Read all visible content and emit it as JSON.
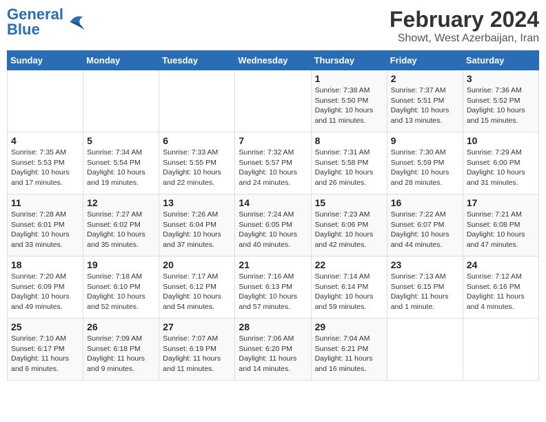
{
  "header": {
    "logo_text_general": "General",
    "logo_text_blue": "Blue",
    "title": "February 2024",
    "subtitle": "Showt, West Azerbaijan, Iran"
  },
  "weekdays": [
    "Sunday",
    "Monday",
    "Tuesday",
    "Wednesday",
    "Thursday",
    "Friday",
    "Saturday"
  ],
  "weeks": [
    [
      {
        "day": "",
        "info": ""
      },
      {
        "day": "",
        "info": ""
      },
      {
        "day": "",
        "info": ""
      },
      {
        "day": "",
        "info": ""
      },
      {
        "day": "1",
        "info": "Sunrise: 7:38 AM\nSunset: 5:50 PM\nDaylight: 10 hours\nand 11 minutes."
      },
      {
        "day": "2",
        "info": "Sunrise: 7:37 AM\nSunset: 5:51 PM\nDaylight: 10 hours\nand 13 minutes."
      },
      {
        "day": "3",
        "info": "Sunrise: 7:36 AM\nSunset: 5:52 PM\nDaylight: 10 hours\nand 15 minutes."
      }
    ],
    [
      {
        "day": "4",
        "info": "Sunrise: 7:35 AM\nSunset: 5:53 PM\nDaylight: 10 hours\nand 17 minutes."
      },
      {
        "day": "5",
        "info": "Sunrise: 7:34 AM\nSunset: 5:54 PM\nDaylight: 10 hours\nand 19 minutes."
      },
      {
        "day": "6",
        "info": "Sunrise: 7:33 AM\nSunset: 5:55 PM\nDaylight: 10 hours\nand 22 minutes."
      },
      {
        "day": "7",
        "info": "Sunrise: 7:32 AM\nSunset: 5:57 PM\nDaylight: 10 hours\nand 24 minutes."
      },
      {
        "day": "8",
        "info": "Sunrise: 7:31 AM\nSunset: 5:58 PM\nDaylight: 10 hours\nand 26 minutes."
      },
      {
        "day": "9",
        "info": "Sunrise: 7:30 AM\nSunset: 5:59 PM\nDaylight: 10 hours\nand 28 minutes."
      },
      {
        "day": "10",
        "info": "Sunrise: 7:29 AM\nSunset: 6:00 PM\nDaylight: 10 hours\nand 31 minutes."
      }
    ],
    [
      {
        "day": "11",
        "info": "Sunrise: 7:28 AM\nSunset: 6:01 PM\nDaylight: 10 hours\nand 33 minutes."
      },
      {
        "day": "12",
        "info": "Sunrise: 7:27 AM\nSunset: 6:02 PM\nDaylight: 10 hours\nand 35 minutes."
      },
      {
        "day": "13",
        "info": "Sunrise: 7:26 AM\nSunset: 6:04 PM\nDaylight: 10 hours\nand 37 minutes."
      },
      {
        "day": "14",
        "info": "Sunrise: 7:24 AM\nSunset: 6:05 PM\nDaylight: 10 hours\nand 40 minutes."
      },
      {
        "day": "15",
        "info": "Sunrise: 7:23 AM\nSunset: 6:06 PM\nDaylight: 10 hours\nand 42 minutes."
      },
      {
        "day": "16",
        "info": "Sunrise: 7:22 AM\nSunset: 6:07 PM\nDaylight: 10 hours\nand 44 minutes."
      },
      {
        "day": "17",
        "info": "Sunrise: 7:21 AM\nSunset: 6:08 PM\nDaylight: 10 hours\nand 47 minutes."
      }
    ],
    [
      {
        "day": "18",
        "info": "Sunrise: 7:20 AM\nSunset: 6:09 PM\nDaylight: 10 hours\nand 49 minutes."
      },
      {
        "day": "19",
        "info": "Sunrise: 7:18 AM\nSunset: 6:10 PM\nDaylight: 10 hours\nand 52 minutes."
      },
      {
        "day": "20",
        "info": "Sunrise: 7:17 AM\nSunset: 6:12 PM\nDaylight: 10 hours\nand 54 minutes."
      },
      {
        "day": "21",
        "info": "Sunrise: 7:16 AM\nSunset: 6:13 PM\nDaylight: 10 hours\nand 57 minutes."
      },
      {
        "day": "22",
        "info": "Sunrise: 7:14 AM\nSunset: 6:14 PM\nDaylight: 10 hours\nand 59 minutes."
      },
      {
        "day": "23",
        "info": "Sunrise: 7:13 AM\nSunset: 6:15 PM\nDaylight: 11 hours\nand 1 minute."
      },
      {
        "day": "24",
        "info": "Sunrise: 7:12 AM\nSunset: 6:16 PM\nDaylight: 11 hours\nand 4 minutes."
      }
    ],
    [
      {
        "day": "25",
        "info": "Sunrise: 7:10 AM\nSunset: 6:17 PM\nDaylight: 11 hours\nand 6 minutes."
      },
      {
        "day": "26",
        "info": "Sunrise: 7:09 AM\nSunset: 6:18 PM\nDaylight: 11 hours\nand 9 minutes."
      },
      {
        "day": "27",
        "info": "Sunrise: 7:07 AM\nSunset: 6:19 PM\nDaylight: 11 hours\nand 11 minutes."
      },
      {
        "day": "28",
        "info": "Sunrise: 7:06 AM\nSunset: 6:20 PM\nDaylight: 11 hours\nand 14 minutes."
      },
      {
        "day": "29",
        "info": "Sunrise: 7:04 AM\nSunset: 6:21 PM\nDaylight: 11 hours\nand 16 minutes."
      },
      {
        "day": "",
        "info": ""
      },
      {
        "day": "",
        "info": ""
      }
    ]
  ]
}
